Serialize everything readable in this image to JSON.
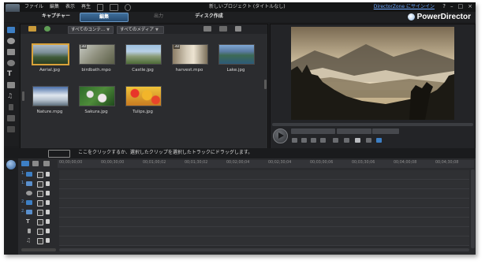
{
  "menu": {
    "items": [
      "ファイル",
      "編集",
      "表示",
      "再生"
    ],
    "window_title": "新しいプロジェクト (タイトルなし)",
    "signin": "DirectorZone にサインイン",
    "help": "?",
    "minimize": "–",
    "maximize": "□",
    "close": "×"
  },
  "modes": {
    "capture": "キャプチャー",
    "edit": "編集",
    "output": "出力",
    "disc": "ディスク作成"
  },
  "brand": {
    "name": "PowerDirector"
  },
  "library": {
    "filter_content": "すべてのコンテ...",
    "filter_media": "すべてのメディア",
    "items": [
      {
        "name": "Aerial.jpg",
        "selected": true,
        "badge": ""
      },
      {
        "name": "birdbath.mpo",
        "selected": false,
        "badge": "3D"
      },
      {
        "name": "Castle.jpg",
        "selected": false,
        "badge": ""
      },
      {
        "name": "harvest.mpo",
        "selected": false,
        "badge": "3D"
      },
      {
        "name": "Lake.jpg",
        "selected": false,
        "badge": ""
      },
      {
        "name": "Nature.mpg",
        "selected": false,
        "badge": ""
      },
      {
        "name": "Sakura.jpg",
        "selected": false,
        "badge": ""
      },
      {
        "name": "Tulips.jpg",
        "selected": false,
        "badge": ""
      }
    ]
  },
  "hint": {
    "text": "ここをクリックするか、選択したクリップを選択したトラックにドラッグします。"
  },
  "timeline": {
    "ticks": [
      "00;00;00;00",
      "00;00;30;00",
      "00;01;00;02",
      "00;01;30;02",
      "00;02;00;04",
      "00;02;30;04",
      "00;03;00;06",
      "00;03;30;06",
      "00;04;00;08",
      "00;04;30;08"
    ],
    "tracks": [
      {
        "num": "1."
      },
      {
        "num": "1."
      },
      {
        "num": ""
      },
      {
        "num": "2."
      },
      {
        "num": "2."
      },
      {
        "num": ""
      },
      {
        "num": ""
      },
      {
        "num": ""
      }
    ]
  },
  "colors": {
    "accent": "#3f6f9c",
    "selection": "#d9a23a",
    "link": "#6aa6ff"
  }
}
